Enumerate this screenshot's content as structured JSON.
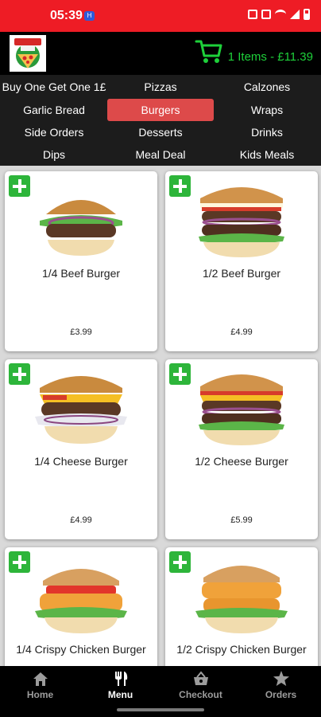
{
  "status_bar": {
    "time": "05:39",
    "badge": "H",
    "icons": [
      "nfc-icon",
      "mute-icon",
      "wifi-icon",
      "signal-icon",
      "battery-icon"
    ]
  },
  "header": {
    "logo_name": "pizza-logo",
    "cart_text": "1 Items - £11.39"
  },
  "categories": [
    {
      "label": "Buy One Get One 1£",
      "active": false
    },
    {
      "label": "Pizzas",
      "active": false
    },
    {
      "label": "Calzones",
      "active": false
    },
    {
      "label": "Garlic Bread",
      "active": false
    },
    {
      "label": "Burgers",
      "active": true
    },
    {
      "label": "Wraps",
      "active": false
    },
    {
      "label": "Side Orders",
      "active": false
    },
    {
      "label": "Desserts",
      "active": false
    },
    {
      "label": "Drinks",
      "active": false
    },
    {
      "label": "Dips",
      "active": false
    },
    {
      "label": "Meal Deal",
      "active": false
    },
    {
      "label": "Kids Meals",
      "active": false
    }
  ],
  "menu_items": [
    {
      "name": "1/4 Beef Burger",
      "price": "£3.99",
      "image": "beef-burger-single"
    },
    {
      "name": "1/2 Beef Burger",
      "price": "£4.99",
      "image": "beef-burger-double"
    },
    {
      "name": "1/4 Cheese Burger",
      "price": "£4.99",
      "image": "cheese-burger-single"
    },
    {
      "name": "1/2 Cheese Burger",
      "price": "£5.99",
      "image": "cheese-burger-double"
    },
    {
      "name": "1/4 Crispy Chicken Burger",
      "price": "",
      "image": "chicken-burger-single"
    },
    {
      "name": "1/2 Crispy Chicken Burger",
      "price": "",
      "image": "chicken-burger-double"
    }
  ],
  "bottom_nav": [
    {
      "label": "Home",
      "icon": "home-icon",
      "active": false
    },
    {
      "label": "Menu",
      "icon": "cutlery-icon",
      "active": true
    },
    {
      "label": "Checkout",
      "icon": "basket-icon",
      "active": false
    },
    {
      "label": "Orders",
      "icon": "star-icon",
      "active": false
    }
  ],
  "colors": {
    "status_bar": "#ee1c25",
    "cart_green": "#1ed03a",
    "active_category": "#dd4a4a",
    "add_button": "#2db53a"
  }
}
